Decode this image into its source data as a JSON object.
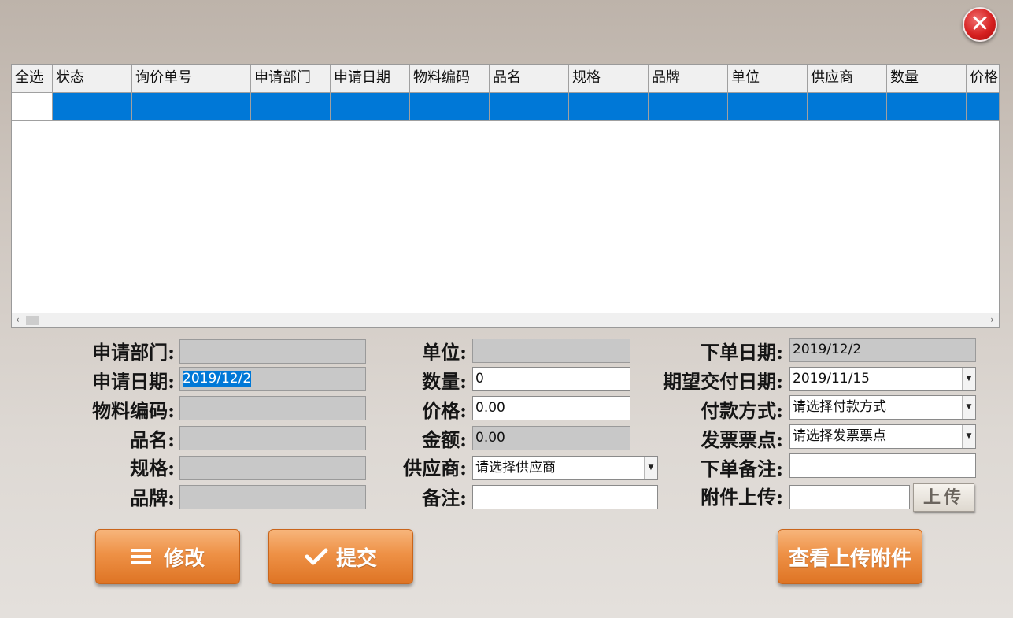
{
  "window": {
    "close_icon": "close-icon",
    "accent": "#d62020"
  },
  "grid": {
    "columns": [
      "全选",
      "状态",
      "询价单号",
      "申请部门",
      "申请日期",
      "物料编码",
      "品名",
      "规格",
      "品牌",
      "单位",
      "供应商",
      "数量",
      "价格"
    ],
    "selected_row_color": "#0078d7",
    "scroll_left": "‹",
    "scroll_right": "›"
  },
  "form": {
    "dept_label": "申请部门:",
    "date_label": "申请日期:",
    "date_value": "2019/12/2",
    "material_code_label": "物料编码:",
    "product_name_label": "品名:",
    "spec_label": "规格:",
    "brand_label": "品牌:",
    "unit_label": "单位:",
    "quantity_label": "数量:",
    "quantity_value": "0",
    "price_label": "价格:",
    "price_value": "0.00",
    "amount_label": "金额:",
    "amount_value": "0.00",
    "supplier_label": "供应商:",
    "supplier_placeholder": "请选择供应商",
    "remark_label": "备注:",
    "order_date_label": "下单日期:",
    "order_date_value": "2019/12/2",
    "delivery_date_label": "期望交付日期:",
    "delivery_date_value": "2019/11/15",
    "payment_label": "付款方式:",
    "payment_placeholder": "请选择付款方式",
    "invoice_label": "发票票点:",
    "invoice_placeholder": "请选择发票票点",
    "order_remark_label": "下单备注:",
    "attachment_label": "附件上传:",
    "upload_button": "上传"
  },
  "actions": {
    "modify_label": "修改",
    "submit_label": "提交",
    "view_attachments_label": "查看上传附件",
    "button_color": "#ee9146"
  }
}
